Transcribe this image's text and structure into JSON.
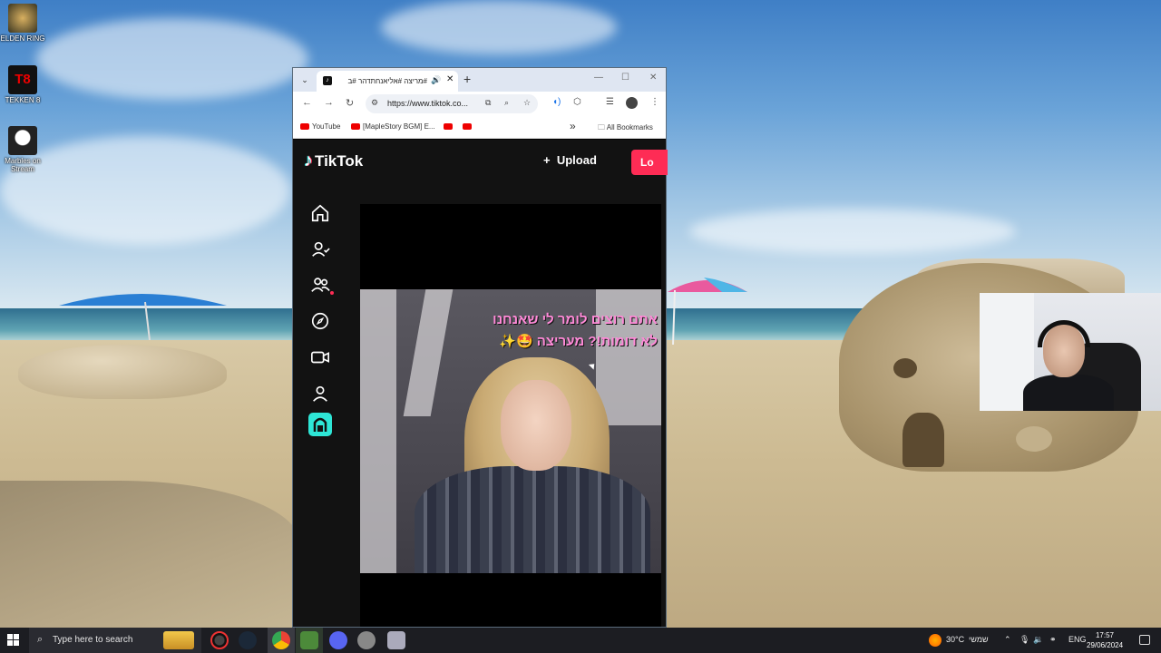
{
  "desktop": {
    "icons": [
      {
        "label": "ELDEN RING"
      },
      {
        "label": "TEKKEN 8",
        "glyph": "T8"
      },
      {
        "label": "Marbles on Stream"
      }
    ]
  },
  "browser": {
    "tab": {
      "title": "#מריצה #אליאנחתדהר #ב",
      "favicon": "tiktok-icon",
      "close": "✕"
    },
    "new_tab": "+",
    "url": "https://www.tiktok.co...",
    "bookmarks": [
      {
        "label": "YouTube"
      },
      {
        "label": "[MapleStory BGM] E..."
      },
      {
        "label": ""
      },
      {
        "label": ""
      }
    ],
    "more_bookmarks": "»",
    "all_bookmarks": "All Bookmarks"
  },
  "tiktok": {
    "logo": "TikTok",
    "upload_label": "Upload",
    "upload_icon": "+",
    "login_label": "Lo",
    "sidebar": [
      "home-icon",
      "following-icon",
      "friends-icon",
      "explore-icon",
      "live-icon",
      "profile-icon",
      "app-icon"
    ],
    "video_caption_line1": "אתם רוצים לומר לי שאנחנו",
    "video_caption_line2": "לא דומות!? מעריצה 🤩✨"
  },
  "taskbar": {
    "search_placeholder": "Type here to search",
    "weather": "30°C",
    "weather_day": "שמשי",
    "language": "ENG",
    "time": "17:57",
    "date": "29/06/2024"
  }
}
